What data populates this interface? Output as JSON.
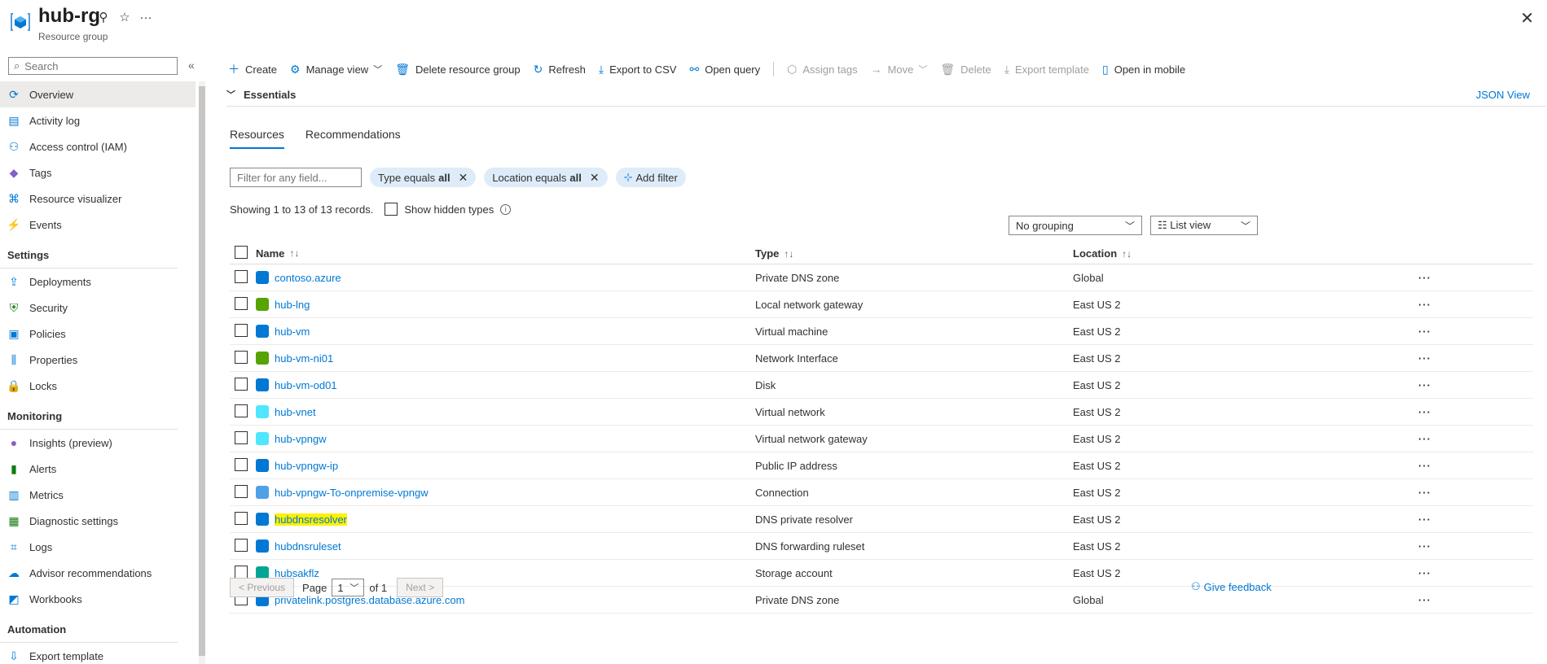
{
  "header": {
    "title": "hub-rg",
    "subtitle": "Resource group"
  },
  "sidebar": {
    "search_placeholder": "Search",
    "items": [
      {
        "label": "Overview",
        "icon": "overview-icon",
        "color": "#0078d4",
        "glyph": "⟳"
      },
      {
        "label": "Activity log",
        "icon": "activity-log-icon",
        "color": "#0078d4",
        "glyph": "▤"
      },
      {
        "label": "Access control (IAM)",
        "icon": "iam-icon",
        "color": "#0078d4",
        "glyph": "⚇"
      },
      {
        "label": "Tags",
        "icon": "tag-icon",
        "color": "#8661c5",
        "glyph": "◆"
      },
      {
        "label": "Resource visualizer",
        "icon": "visualizer-icon",
        "color": "#0078d4",
        "glyph": "⌘"
      },
      {
        "label": "Events",
        "icon": "events-icon",
        "color": "#ffb900",
        "glyph": "⚡"
      }
    ],
    "sections": [
      {
        "title": "Settings",
        "items": [
          {
            "label": "Deployments",
            "icon": "deployments-icon",
            "color": "#0078d4",
            "glyph": "⇪"
          },
          {
            "label": "Security",
            "icon": "shield-icon",
            "color": "#107c10",
            "glyph": "⛨"
          },
          {
            "label": "Policies",
            "icon": "policies-icon",
            "color": "#0078d4",
            "glyph": "▣"
          },
          {
            "label": "Properties",
            "icon": "properties-icon",
            "color": "#0078d4",
            "glyph": "⫼"
          },
          {
            "label": "Locks",
            "icon": "lock-icon",
            "color": "#0078d4",
            "glyph": "🔒"
          }
        ]
      },
      {
        "title": "Monitoring",
        "items": [
          {
            "label": "Insights (preview)",
            "icon": "insights-icon",
            "color": "#8661c5",
            "glyph": "●"
          },
          {
            "label": "Alerts",
            "icon": "alerts-icon",
            "color": "#107c10",
            "glyph": "▮"
          },
          {
            "label": "Metrics",
            "icon": "metrics-icon",
            "color": "#0078d4",
            "glyph": "▥"
          },
          {
            "label": "Diagnostic settings",
            "icon": "diagnostic-icon",
            "color": "#107c10",
            "glyph": "▦"
          },
          {
            "label": "Logs",
            "icon": "logs-icon",
            "color": "#0078d4",
            "glyph": "⌗"
          },
          {
            "label": "Advisor recommendations",
            "icon": "advisor-icon",
            "color": "#0078d4",
            "glyph": "☁"
          },
          {
            "label": "Workbooks",
            "icon": "workbooks-icon",
            "color": "#0078d4",
            "glyph": "◩"
          }
        ]
      },
      {
        "title": "Automation",
        "items": [
          {
            "label": "Export template",
            "icon": "export-template-icon",
            "color": "#0078d4",
            "glyph": "⇩"
          }
        ]
      }
    ]
  },
  "toolbar": {
    "create": "Create",
    "manage_view": "Manage view",
    "delete_rg": "Delete resource group",
    "refresh": "Refresh",
    "export_csv": "Export to CSV",
    "open_query": "Open query",
    "assign_tags": "Assign tags",
    "move": "Move",
    "delete": "Delete",
    "export_template": "Export template",
    "open_mobile": "Open in mobile"
  },
  "essentials": {
    "label": "Essentials",
    "json_view": "JSON View"
  },
  "tabs": [
    {
      "label": "Resources",
      "active": true
    },
    {
      "label": "Recommendations",
      "active": false
    }
  ],
  "filters": {
    "placeholder": "Filter for any field...",
    "type_prefix": "Type equals",
    "type_value": "all",
    "location_prefix": "Location equals",
    "location_value": "all",
    "add_filter": "Add filter"
  },
  "records": {
    "showing": "Showing 1 to 13 of 13 records.",
    "show_hidden": "Show hidden types"
  },
  "grouping": {
    "selected": "No grouping"
  },
  "view": {
    "selected": "List view"
  },
  "table": {
    "columns": {
      "name": "Name",
      "type": "Type",
      "location": "Location"
    },
    "rows": [
      {
        "name": "contoso.azure",
        "type": "Private DNS zone",
        "location": "Global",
        "icon": "dns-zone-icon",
        "color": "#0078d4",
        "highlight": false
      },
      {
        "name": "hub-lng",
        "type": "Local network gateway",
        "location": "East US 2",
        "icon": "local-network-gateway-icon",
        "color": "#57a300",
        "highlight": false
      },
      {
        "name": "hub-vm",
        "type": "Virtual machine",
        "location": "East US 2",
        "icon": "virtual-machine-icon",
        "color": "#0078d4",
        "highlight": false
      },
      {
        "name": "hub-vm-ni01",
        "type": "Network Interface",
        "location": "East US 2",
        "icon": "network-interface-icon",
        "color": "#57a300",
        "highlight": false
      },
      {
        "name": "hub-vm-od01",
        "type": "Disk",
        "location": "East US 2",
        "icon": "disk-icon",
        "color": "#0078d4",
        "highlight": false
      },
      {
        "name": "hub-vnet",
        "type": "Virtual network",
        "location": "East US 2",
        "icon": "vnet-icon",
        "color": "#50e6ff",
        "highlight": false
      },
      {
        "name": "hub-vpngw",
        "type": "Virtual network gateway",
        "location": "East US 2",
        "icon": "vpn-gateway-icon",
        "color": "#50e6ff",
        "highlight": false
      },
      {
        "name": "hub-vpngw-ip",
        "type": "Public IP address",
        "location": "East US 2",
        "icon": "public-ip-icon",
        "color": "#0078d4",
        "highlight": false
      },
      {
        "name": "hub-vpngw-To-onpremise-vpngw",
        "type": "Connection",
        "location": "East US 2",
        "icon": "connection-icon",
        "color": "#50a0e6",
        "highlight": false
      },
      {
        "name": "hubdnsresolver",
        "type": "DNS private resolver",
        "location": "East US 2",
        "icon": "dns-resolver-icon",
        "color": "#0078d4",
        "highlight": true
      },
      {
        "name": "hubdnsruleset",
        "type": "DNS forwarding ruleset",
        "location": "East US 2",
        "icon": "dns-ruleset-icon",
        "color": "#0078d4",
        "highlight": false
      },
      {
        "name": "hubsakflz",
        "type": "Storage account",
        "location": "East US 2",
        "icon": "storage-account-icon",
        "color": "#00a693",
        "highlight": false
      },
      {
        "name": "privatelink.postgres.database.azure.com",
        "type": "Private DNS zone",
        "location": "Global",
        "icon": "dns-zone-icon",
        "color": "#0078d4",
        "highlight": false
      }
    ]
  },
  "pager": {
    "previous": "< Previous",
    "page_label": "Page",
    "page_value": "1",
    "of_label": "of 1",
    "next": "Next >"
  },
  "feedback": "Give feedback"
}
